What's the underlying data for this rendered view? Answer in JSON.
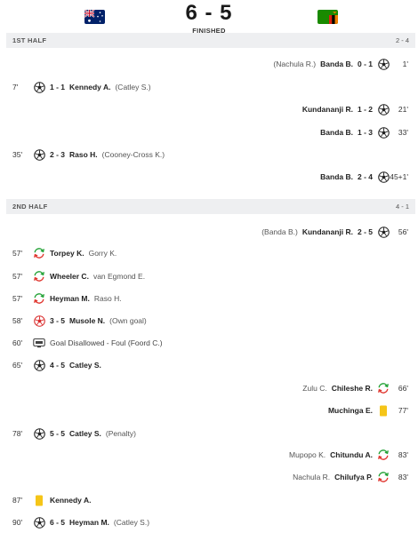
{
  "header": {
    "score": "6 - 5",
    "status": "FINISHED"
  },
  "first_half": {
    "label": "1ST HALF",
    "score": "2 - 4"
  },
  "second_half": {
    "label": "2ND HALF",
    "score": "4 - 1"
  },
  "events": [
    {
      "side": "away",
      "icon": "football-icon",
      "minute": "1'",
      "score": "0 - 1",
      "player": "Banda B.",
      "secondary": "(Nachula R.)"
    },
    {
      "side": "home",
      "icon": "football-icon",
      "minute": "7'",
      "score": "1 - 1",
      "player": "Kennedy A.",
      "secondary": "(Catley S.)"
    },
    {
      "side": "away",
      "icon": "football-icon",
      "minute": "21'",
      "score": "1 - 2",
      "player": "Kundananji R.",
      "secondary": ""
    },
    {
      "side": "away",
      "icon": "football-icon",
      "minute": "33'",
      "score": "1 - 3",
      "player": "Banda B.",
      "secondary": ""
    },
    {
      "side": "home",
      "icon": "football-icon",
      "minute": "35'",
      "score": "2 - 3",
      "player": "Raso H.",
      "secondary": "(Cooney-Cross K.)"
    },
    {
      "side": "away",
      "icon": "football-icon",
      "minute": "45+1'",
      "score": "2 - 4",
      "player": "Banda B.",
      "secondary": ""
    },
    {
      "side": "away",
      "icon": "football-icon",
      "minute": "56'",
      "score": "2 - 5",
      "player": "Kundananji R.",
      "secondary": "(Banda B.)"
    },
    {
      "side": "home",
      "icon": "substitution-icon",
      "minute": "57'",
      "score": "",
      "player": "Torpey K.",
      "secondary": "Gorry K."
    },
    {
      "side": "home",
      "icon": "substitution-icon",
      "minute": "57'",
      "score": "",
      "player": "Wheeler C.",
      "secondary": "van Egmond E."
    },
    {
      "side": "home",
      "icon": "substitution-icon",
      "minute": "57'",
      "score": "",
      "player": "Heyman M.",
      "secondary": "Raso H."
    },
    {
      "side": "home",
      "icon": "own-goal-icon",
      "minute": "58'",
      "score": "3 - 5",
      "player": "Musole N.",
      "secondary": "(Own goal)"
    },
    {
      "side": "home",
      "icon": "var-icon",
      "minute": "60'",
      "score": "",
      "player": "",
      "secondary": "",
      "text": "Goal Disallowed - Foul (Foord C.)"
    },
    {
      "side": "home",
      "icon": "football-icon",
      "minute": "65'",
      "score": "4 - 5",
      "player": "Catley S.",
      "secondary": ""
    },
    {
      "side": "away",
      "icon": "substitution-icon",
      "minute": "66'",
      "score": "",
      "player": "Chileshe R.",
      "secondary": "Zulu C."
    },
    {
      "side": "away",
      "icon": "yellow-card-icon",
      "minute": "77'",
      "score": "",
      "player": "Muchinga E.",
      "secondary": ""
    },
    {
      "side": "home",
      "icon": "football-icon",
      "minute": "78'",
      "score": "5 - 5",
      "player": "Catley S.",
      "secondary": "(Penalty)"
    },
    {
      "side": "away",
      "icon": "substitution-icon",
      "minute": "83'",
      "score": "",
      "player": "Chitundu A.",
      "secondary": "Mupopo K."
    },
    {
      "side": "away",
      "icon": "substitution-icon",
      "minute": "83'",
      "score": "",
      "player": "Chilufya P.",
      "secondary": "Nachula R."
    },
    {
      "side": "home",
      "icon": "yellow-card-icon",
      "minute": "87'",
      "score": "",
      "player": "Kennedy A.",
      "secondary": ""
    },
    {
      "side": "home",
      "icon": "football-icon",
      "minute": "90'",
      "score": "6 - 5",
      "player": "Heyman M.",
      "secondary": "(Catley S.)"
    }
  ],
  "colors": {
    "period_bar": "#eeeff1",
    "sub_green": "#23a236",
    "sub_red": "#e0342d",
    "yellow_card": "#f5c518",
    "own_goal": "#d92b2b"
  }
}
